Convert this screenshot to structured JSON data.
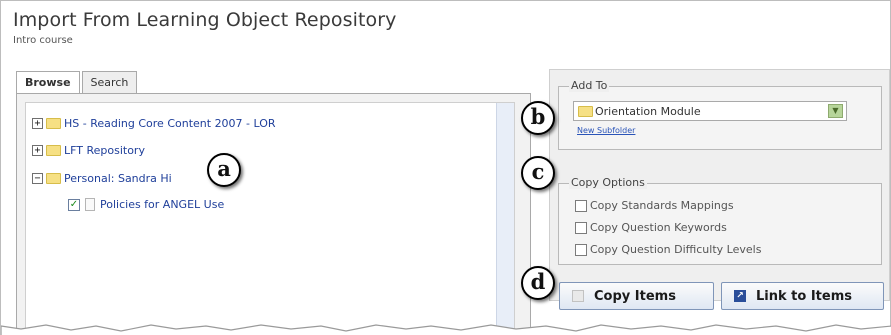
{
  "window": {
    "title": "Import From Learning Object Repository",
    "subtitle": "Intro course"
  },
  "tabs": [
    {
      "label": "Browse",
      "active": true
    },
    {
      "label": "Search",
      "active": false
    }
  ],
  "tree": [
    {
      "label": "HS - Reading Core Content 2007 - LOR",
      "expander": "+"
    },
    {
      "label": "LFT Repository",
      "expander": "+"
    },
    {
      "label": "Personal: Sandra Hi",
      "expander": "−"
    },
    {
      "label": "Policies for ANGEL Use",
      "checked": true
    }
  ],
  "add_to": {
    "legend": "Add To",
    "selected": "Orientation Module",
    "new_subfolder": "New Subfolder"
  },
  "copy_options": {
    "legend": "Copy Options",
    "options": [
      {
        "label": "Copy Standards Mappings",
        "checked": false
      },
      {
        "label": "Copy Question Keywords",
        "checked": false
      },
      {
        "label": "Copy Question Difficulty Levels",
        "checked": false
      }
    ]
  },
  "buttons": {
    "copy": "Copy Items",
    "link": "Link to Items"
  },
  "callouts": {
    "a": "a",
    "b": "b",
    "c": "c",
    "d": "d"
  },
  "icons": [
    "plus-expander-icon",
    "minus-expander-icon",
    "folder-icon",
    "checkbox-checked-icon",
    "document-icon",
    "dropdown-arrow-icon",
    "copy-icon",
    "link-arrow-icon"
  ]
}
